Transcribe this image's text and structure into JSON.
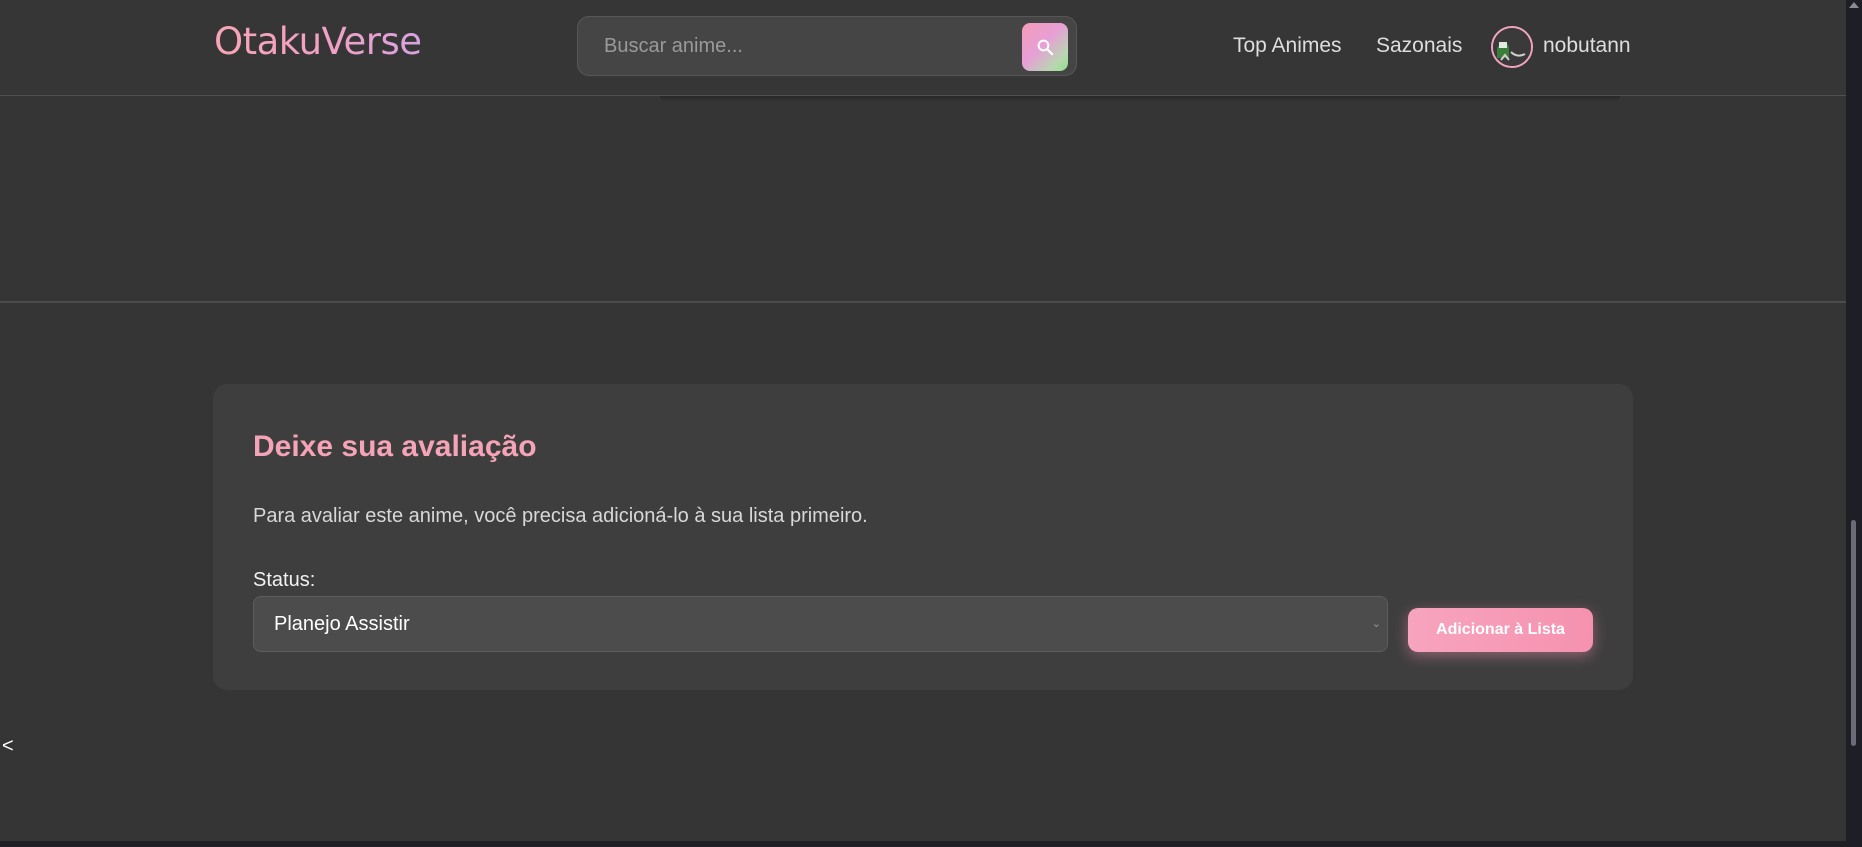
{
  "header": {
    "logo": "OtakuVerse",
    "search": {
      "placeholder": "Buscar anime...",
      "value": ""
    },
    "nav": [
      "Top Animes",
      "Sazonais"
    ],
    "user": {
      "name": "nobutann"
    }
  },
  "review": {
    "title": "Deixe sua avaliação",
    "message": "Para avaliar este anime, você precisa adicioná-lo à sua lista primeiro.",
    "status_label": "Status:",
    "status_value": "Planejo Assistir",
    "add_button": "Adicionar à Lista"
  },
  "back_arrow": "<",
  "colors": {
    "accent_pink": "#f5a3b6",
    "background": "#353535",
    "card": "#3e3e3e"
  },
  "icons": [
    "search-icon",
    "avatar-image",
    "chevron-down-icon"
  ]
}
